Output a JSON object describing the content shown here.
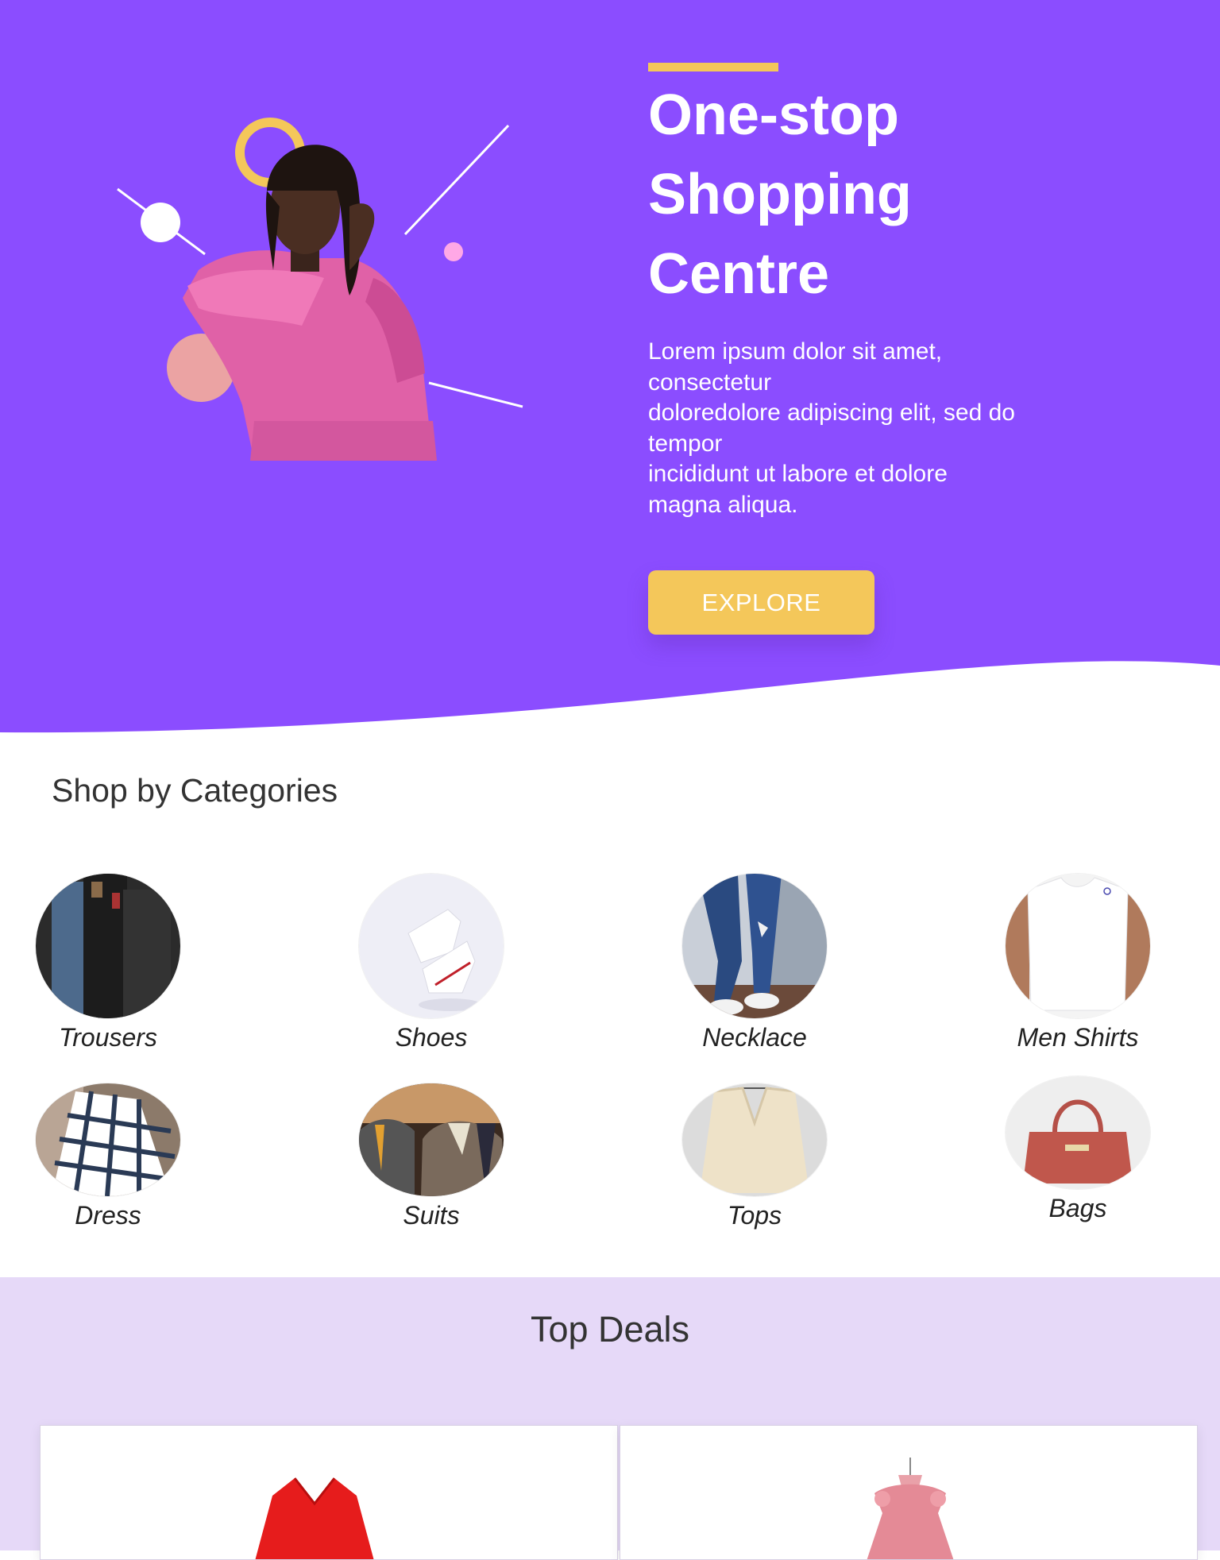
{
  "hero": {
    "title_lines": [
      "One-stop",
      "Shopping",
      "Centre"
    ],
    "description_lines": [
      "Lorem ipsum dolor sit amet,",
      "consectetur",
      "doloredolore adipiscing elit, sed do",
      "tempor",
      "incididunt ut labore et dolore",
      "magna aliqua."
    ],
    "explore_label": "EXPLORE"
  },
  "categories": {
    "title": "Shop by Categories",
    "items": [
      {
        "label": "Trousers",
        "icon": "trousers-image"
      },
      {
        "label": "Shoes",
        "icon": "shoes-image"
      },
      {
        "label": "Necklace",
        "icon": "necklace-image"
      },
      {
        "label": "Men Shirts",
        "icon": "men-shirts-image"
      },
      {
        "label": "Dress",
        "icon": "dress-image"
      },
      {
        "label": "Suits",
        "icon": "suits-image"
      },
      {
        "label": "Tops",
        "icon": "tops-image"
      },
      {
        "label": "Bags",
        "icon": "bags-image"
      }
    ]
  },
  "deals": {
    "title": "Top Deals",
    "cards": [
      {
        "icon": "red-dress-image"
      },
      {
        "icon": "pink-dress-image"
      }
    ]
  },
  "colors": {
    "hero_purple": "#8b4dff",
    "accent_yellow": "#f4c75a",
    "deals_bg": "#e6d9f8"
  }
}
